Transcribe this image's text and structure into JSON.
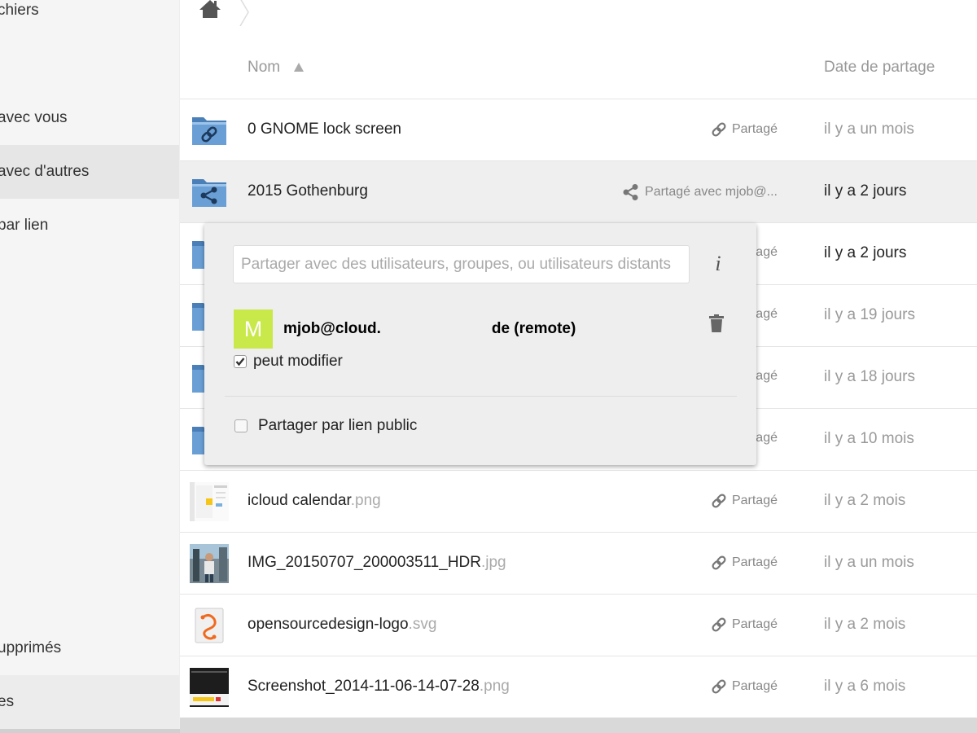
{
  "sidebar": {
    "items": [
      {
        "label": "chiers",
        "active": false
      },
      {
        "label": "avec vous",
        "active": false
      },
      {
        "label": "avec d'autres",
        "active": true
      },
      {
        "label": "par lien",
        "active": false
      },
      {
        "label": "upprimés",
        "active": false
      },
      {
        "label": "es",
        "active": false
      }
    ]
  },
  "header": {
    "name_label": "Nom",
    "date_label": "Date de partage"
  },
  "files": [
    {
      "name": "0 GNOME lock screen",
      "ext": "",
      "share": "Partagé",
      "date": "il y a un mois"
    },
    {
      "name": "2015 Gothenburg",
      "ext": "",
      "share": "Partagé avec mjob@...",
      "date": "il y a 2 jours"
    },
    {
      "name": "",
      "ext": "",
      "share": "agé",
      "date": "il y a 2 jours"
    },
    {
      "name": "",
      "ext": "",
      "share": "agé",
      "date": "il y a 19 jours"
    },
    {
      "name": "",
      "ext": "",
      "share": "agé",
      "date": "il y a 18 jours"
    },
    {
      "name": "",
      "ext": "",
      "share": "agé",
      "date": "il y a 10 mois"
    },
    {
      "name": "icloud calendar",
      "ext": ".png",
      "share": "Partagé",
      "date": "il y a 2 mois"
    },
    {
      "name": "IMG_20150707_200003511_HDR",
      "ext": ".jpg",
      "share": "Partagé",
      "date": "il y a un mois"
    },
    {
      "name": "opensourcedesign-logo",
      "ext": ".svg",
      "share": "Partagé",
      "date": "il y a 2 mois"
    },
    {
      "name": "Screenshot_2014-11-06-14-07-28",
      "ext": ".png",
      "share": "Partagé",
      "date": "il y a 6 mois"
    }
  ],
  "share_dropdown": {
    "placeholder": "Partager avec des utilisateurs, groupes, ou utilisateurs distants",
    "info_icon": "i",
    "avatar_letter": "M",
    "recipient_prefix": "mjob@cloud.",
    "recipient_suffix": "de (remote)",
    "can_edit_label": "peut modifier",
    "can_edit_checked": true,
    "link_label": "Partager par lien public",
    "link_checked": false
  },
  "colors": {
    "avatar": "#c9e84a",
    "folder": "#5a8fc7",
    "sidebar_bg": "#f5f5f5",
    "sidebar_active": "#e6e6e6"
  }
}
